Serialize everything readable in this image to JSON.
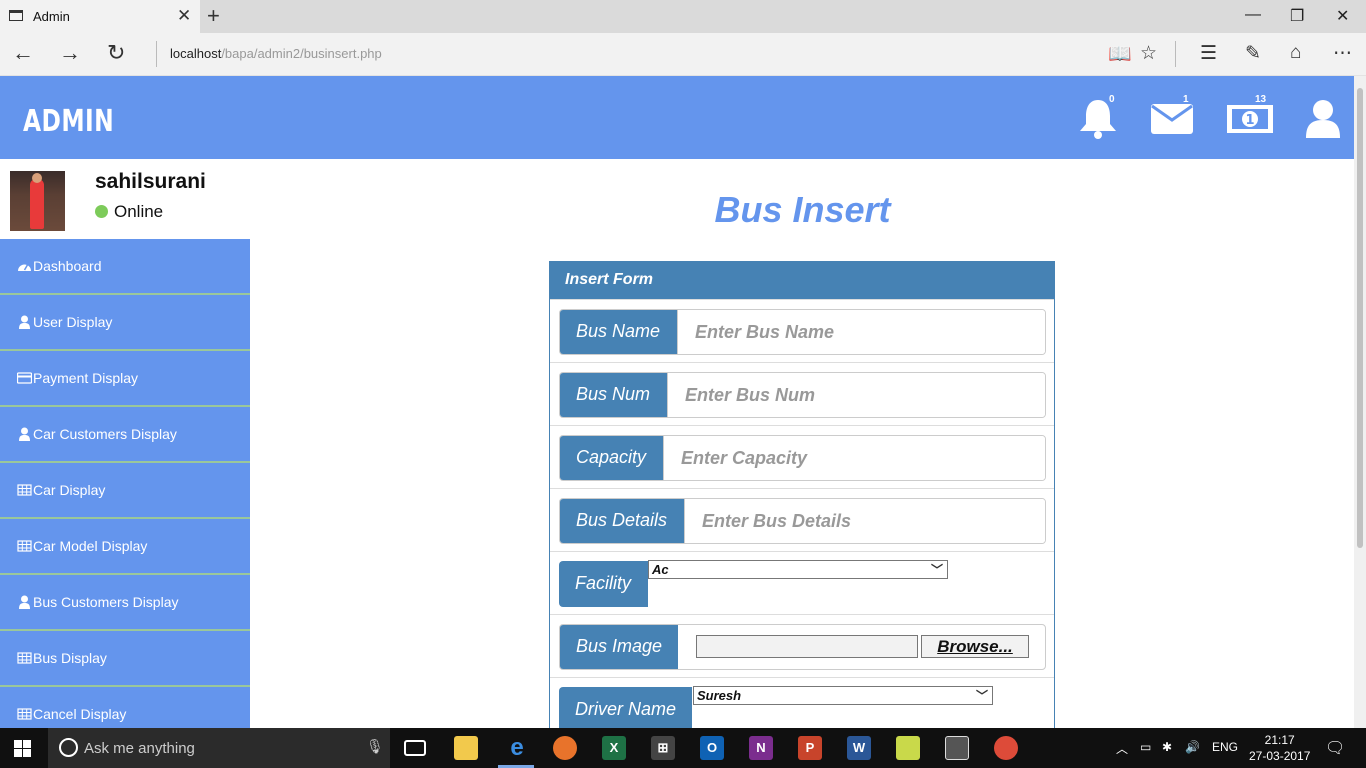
{
  "browser": {
    "tab_title": "Admin",
    "url_host": "localhost",
    "url_path": "/bapa/admin2/businsert.php"
  },
  "header": {
    "brand": "ADMIN",
    "notifications_count": "0",
    "messages_count": "1",
    "payments_count": "13",
    "brand_color": "#6495ed"
  },
  "profile": {
    "username": "sahilsurani",
    "status": "Online"
  },
  "sidebar": {
    "items": [
      {
        "label": "Dashboard",
        "icon": "dashboard-icon"
      },
      {
        "label": "User Display",
        "icon": "user-icon"
      },
      {
        "label": "Payment Display",
        "icon": "credit-card-icon"
      },
      {
        "label": "Car Customers Display",
        "icon": "user-icon"
      },
      {
        "label": "Car Display",
        "icon": "table-icon"
      },
      {
        "label": "Car Model Display",
        "icon": "table-icon"
      },
      {
        "label": "Bus Customers Display",
        "icon": "user-icon"
      },
      {
        "label": "Bus Display",
        "icon": "table-icon"
      },
      {
        "label": "Cancel Display",
        "icon": "table-icon"
      }
    ]
  },
  "main": {
    "title": "Bus Insert",
    "panel_title": "Insert Form",
    "fields": {
      "bus_name": {
        "label": "Bus Name",
        "placeholder": "Enter Bus Name"
      },
      "bus_num": {
        "label": "Bus Num",
        "placeholder": "Enter Bus Num"
      },
      "capacity": {
        "label": "Capacity",
        "placeholder": "Enter Capacity"
      },
      "bus_details": {
        "label": "Bus Details",
        "placeholder": "Enter Bus Details"
      },
      "facility": {
        "label": "Facility",
        "selected": "Ac"
      },
      "bus_image": {
        "label": "Bus Image",
        "button": "Browse..."
      },
      "driver_name": {
        "label": "Driver Name",
        "selected": "Suresh"
      }
    }
  },
  "taskbar": {
    "search_placeholder": "Ask me anything",
    "language": "ENG",
    "time": "21:17",
    "date": "27-03-2017"
  }
}
